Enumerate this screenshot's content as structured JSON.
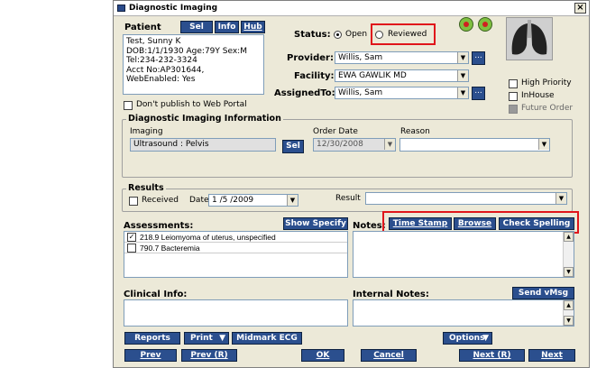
{
  "window": {
    "title": "Diagnostic Imaging",
    "close": "×"
  },
  "patient": {
    "heading": "Patient",
    "sel_btn": "Sel",
    "info_btn": "Info",
    "hub_btn": "Hub",
    "lines": [
      "Test, Sunny K",
      "DOB:1/1/1930  Age:79Y  Sex:M",
      "Tel:234-232-3324",
      "Acct No:AP301644,",
      "WebEnabled: Yes"
    ]
  },
  "status": {
    "label": "Status:",
    "open": "Open",
    "reviewed": "Reviewed",
    "selected": "Open"
  },
  "provider": {
    "label": "Provider:",
    "value": "Willis, Sam"
  },
  "facility": {
    "label": "Facility:",
    "value": "EWA GAWLIK MD"
  },
  "assigned_to": {
    "label": "AssignedTo:",
    "value": "Willis, Sam"
  },
  "dont_publish": {
    "label": "Don't publish to Web Portal",
    "checked": false
  },
  "flags": {
    "high_priority": "High Priority",
    "inhouse": "InHouse",
    "future_order": "Future Order"
  },
  "di_info": {
    "title": "Diagnostic Imaging Information",
    "imaging_label": "Imaging",
    "imaging_value": "Ultrasound : Pelvis",
    "sel_btn": "Sel",
    "order_date_label": "Order Date",
    "order_date_value": "12/30/2008",
    "reason_label": "Reason",
    "reason_value": ""
  },
  "results": {
    "title": "Results",
    "received_label": "Received",
    "date_label": "Date",
    "date_value": "1 /5 /2009",
    "result_label": "Result",
    "result_value": ""
  },
  "assessments": {
    "label": "Assessments:",
    "show_specify": "Show Specify",
    "items": [
      {
        "checked": true,
        "text": "218.9 Leiomyoma of uterus, unspecified"
      },
      {
        "checked": false,
        "text": "790.7 Bacteremia"
      }
    ]
  },
  "notes": {
    "label": "Notes:",
    "time_stamp": "Time Stamp",
    "browse": "Browse",
    "check_spelling": "Check Spelling"
  },
  "clinical_info": {
    "label": "Clinical Info:"
  },
  "internal_notes": {
    "label": "Internal Notes:",
    "send_vmsg": "Send vMsg"
  },
  "bottom": {
    "reports": "Reports",
    "print": "Print",
    "midmark_ecg": "Midmark ECG",
    "options": "Options",
    "prev": "Prev",
    "prev_r": "Prev (R)",
    "ok": "OK",
    "cancel": "Cancel",
    "next_r": "Next (R)",
    "next": "Next"
  }
}
